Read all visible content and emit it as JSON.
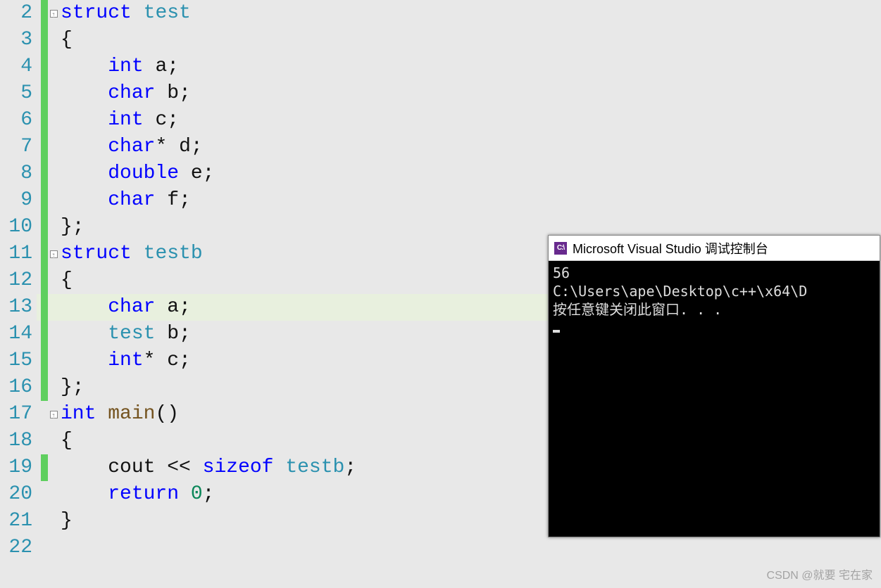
{
  "editor": {
    "lines": [
      {
        "num": "2",
        "changed": true,
        "fold": true,
        "outline": "start",
        "highlight": false,
        "tokens": [
          {
            "t": "kw",
            "v": "struct"
          },
          {
            "t": "sp",
            "v": " "
          },
          {
            "t": "type",
            "v": "test"
          }
        ]
      },
      {
        "num": "3",
        "changed": true,
        "fold": false,
        "outline": "mid",
        "highlight": false,
        "tokens": [
          {
            "t": "op",
            "v": "{"
          }
        ]
      },
      {
        "num": "4",
        "changed": true,
        "fold": false,
        "outline": "mid",
        "highlight": false,
        "tokens": [
          {
            "t": "sp",
            "v": "    "
          },
          {
            "t": "kw",
            "v": "int"
          },
          {
            "t": "sp",
            "v": " "
          },
          {
            "t": "ident",
            "v": "a"
          },
          {
            "t": "op",
            "v": ";"
          }
        ]
      },
      {
        "num": "5",
        "changed": true,
        "fold": false,
        "outline": "mid",
        "highlight": false,
        "tokens": [
          {
            "t": "sp",
            "v": "    "
          },
          {
            "t": "kw",
            "v": "char"
          },
          {
            "t": "sp",
            "v": " "
          },
          {
            "t": "ident",
            "v": "b"
          },
          {
            "t": "op",
            "v": ";"
          }
        ]
      },
      {
        "num": "6",
        "changed": true,
        "fold": false,
        "outline": "mid",
        "highlight": false,
        "tokens": [
          {
            "t": "sp",
            "v": "    "
          },
          {
            "t": "kw",
            "v": "int"
          },
          {
            "t": "sp",
            "v": " "
          },
          {
            "t": "ident",
            "v": "c"
          },
          {
            "t": "op",
            "v": ";"
          }
        ]
      },
      {
        "num": "7",
        "changed": true,
        "fold": false,
        "outline": "mid",
        "highlight": false,
        "tokens": [
          {
            "t": "sp",
            "v": "    "
          },
          {
            "t": "kw",
            "v": "char"
          },
          {
            "t": "op",
            "v": "*"
          },
          {
            "t": "sp",
            "v": " "
          },
          {
            "t": "ident",
            "v": "d"
          },
          {
            "t": "op",
            "v": ";"
          }
        ]
      },
      {
        "num": "8",
        "changed": true,
        "fold": false,
        "outline": "mid",
        "highlight": false,
        "tokens": [
          {
            "t": "sp",
            "v": "    "
          },
          {
            "t": "kw",
            "v": "double"
          },
          {
            "t": "sp",
            "v": " "
          },
          {
            "t": "ident",
            "v": "e"
          },
          {
            "t": "op",
            "v": ";"
          }
        ]
      },
      {
        "num": "9",
        "changed": true,
        "fold": false,
        "outline": "mid",
        "highlight": false,
        "tokens": [
          {
            "t": "sp",
            "v": "    "
          },
          {
            "t": "kw",
            "v": "char"
          },
          {
            "t": "sp",
            "v": " "
          },
          {
            "t": "ident",
            "v": "f"
          },
          {
            "t": "op",
            "v": ";"
          }
        ]
      },
      {
        "num": "10",
        "changed": true,
        "fold": false,
        "outline": "end",
        "highlight": false,
        "tokens": [
          {
            "t": "op",
            "v": "};"
          }
        ]
      },
      {
        "num": "11",
        "changed": true,
        "fold": true,
        "outline": "start",
        "highlight": false,
        "tokens": [
          {
            "t": "kw",
            "v": "struct"
          },
          {
            "t": "sp",
            "v": " "
          },
          {
            "t": "type",
            "v": "testb"
          }
        ]
      },
      {
        "num": "12",
        "changed": true,
        "fold": false,
        "outline": "mid",
        "highlight": false,
        "tokens": [
          {
            "t": "op",
            "v": "{"
          }
        ]
      },
      {
        "num": "13",
        "changed": true,
        "fold": false,
        "outline": "mid",
        "highlight": true,
        "tokens": [
          {
            "t": "sp",
            "v": "    "
          },
          {
            "t": "kw",
            "v": "char"
          },
          {
            "t": "sp",
            "v": " "
          },
          {
            "t": "ident",
            "v": "a"
          },
          {
            "t": "op",
            "v": ";"
          }
        ]
      },
      {
        "num": "14",
        "changed": true,
        "fold": false,
        "outline": "mid",
        "highlight": false,
        "tokens": [
          {
            "t": "sp",
            "v": "    "
          },
          {
            "t": "type",
            "v": "test"
          },
          {
            "t": "sp",
            "v": " "
          },
          {
            "t": "ident",
            "v": "b"
          },
          {
            "t": "op",
            "v": ";"
          }
        ]
      },
      {
        "num": "15",
        "changed": true,
        "fold": false,
        "outline": "mid",
        "highlight": false,
        "tokens": [
          {
            "t": "sp",
            "v": "    "
          },
          {
            "t": "kw",
            "v": "int"
          },
          {
            "t": "op",
            "v": "*"
          },
          {
            "t": "sp",
            "v": " "
          },
          {
            "t": "ident",
            "v": "c"
          },
          {
            "t": "op",
            "v": ";"
          }
        ]
      },
      {
        "num": "16",
        "changed": true,
        "fold": false,
        "outline": "end",
        "highlight": false,
        "tokens": [
          {
            "t": "op",
            "v": "};"
          }
        ]
      },
      {
        "num": "17",
        "changed": false,
        "fold": true,
        "outline": "start",
        "highlight": false,
        "tokens": [
          {
            "t": "kw",
            "v": "int"
          },
          {
            "t": "sp",
            "v": " "
          },
          {
            "t": "func",
            "v": "main"
          },
          {
            "t": "op",
            "v": "()"
          }
        ]
      },
      {
        "num": "18",
        "changed": false,
        "fold": false,
        "outline": "mid",
        "highlight": false,
        "tokens": [
          {
            "t": "op",
            "v": "{"
          }
        ]
      },
      {
        "num": "19",
        "changed": true,
        "fold": false,
        "outline": "mid",
        "highlight": false,
        "tokens": [
          {
            "t": "sp",
            "v": "    "
          },
          {
            "t": "ident",
            "v": "cout"
          },
          {
            "t": "sp",
            "v": " "
          },
          {
            "t": "op",
            "v": "<<"
          },
          {
            "t": "sp",
            "v": " "
          },
          {
            "t": "kw",
            "v": "sizeof"
          },
          {
            "t": "sp",
            "v": " "
          },
          {
            "t": "type",
            "v": "testb"
          },
          {
            "t": "op",
            "v": ";"
          }
        ]
      },
      {
        "num": "20",
        "changed": false,
        "fold": false,
        "outline": "mid",
        "highlight": false,
        "tokens": [
          {
            "t": "sp",
            "v": "    "
          },
          {
            "t": "kw",
            "v": "return"
          },
          {
            "t": "sp",
            "v": " "
          },
          {
            "t": "num",
            "v": "0"
          },
          {
            "t": "op",
            "v": ";"
          }
        ]
      },
      {
        "num": "21",
        "changed": false,
        "fold": false,
        "outline": "end",
        "highlight": false,
        "tokens": [
          {
            "t": "op",
            "v": "}"
          }
        ]
      },
      {
        "num": "22",
        "changed": false,
        "fold": false,
        "outline": "none",
        "highlight": false,
        "tokens": []
      }
    ]
  },
  "console": {
    "title": "Microsoft Visual Studio 调试控制台",
    "icon_text": "C:\\",
    "lines": [
      "56",
      "C:\\Users\\ape\\Desktop\\c++\\x64\\D",
      "按任意键关闭此窗口. . ."
    ]
  },
  "watermark": "CSDN @就要 宅在家"
}
